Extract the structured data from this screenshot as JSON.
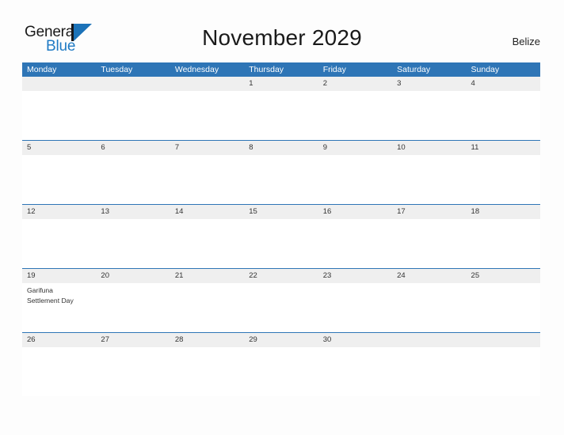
{
  "brand": {
    "name_part1": "General",
    "name_part2": "Blue",
    "flag_icon": "flag-triangle-icon",
    "accent_color": "#1b72b8"
  },
  "header": {
    "title": "November 2029",
    "country": "Belize"
  },
  "theme": {
    "header_blue": "#2e75b6",
    "band_gray": "#efefef",
    "page_background": "#fdfdfd",
    "text_color": "#333333"
  },
  "calendar": {
    "month": "November",
    "year": "2029",
    "first_day_of_week": "Monday",
    "weekday_headers": [
      "Monday",
      "Tuesday",
      "Wednesday",
      "Thursday",
      "Friday",
      "Saturday",
      "Sunday"
    ],
    "weeks": [
      {
        "days": [
          {
            "num": "",
            "event": ""
          },
          {
            "num": "",
            "event": ""
          },
          {
            "num": "",
            "event": ""
          },
          {
            "num": "1",
            "event": ""
          },
          {
            "num": "2",
            "event": ""
          },
          {
            "num": "3",
            "event": ""
          },
          {
            "num": "4",
            "event": ""
          }
        ]
      },
      {
        "days": [
          {
            "num": "5",
            "event": ""
          },
          {
            "num": "6",
            "event": ""
          },
          {
            "num": "7",
            "event": ""
          },
          {
            "num": "8",
            "event": ""
          },
          {
            "num": "9",
            "event": ""
          },
          {
            "num": "10",
            "event": ""
          },
          {
            "num": "11",
            "event": ""
          }
        ]
      },
      {
        "days": [
          {
            "num": "12",
            "event": ""
          },
          {
            "num": "13",
            "event": ""
          },
          {
            "num": "14",
            "event": ""
          },
          {
            "num": "15",
            "event": ""
          },
          {
            "num": "16",
            "event": ""
          },
          {
            "num": "17",
            "event": ""
          },
          {
            "num": "18",
            "event": ""
          }
        ]
      },
      {
        "days": [
          {
            "num": "19",
            "event": "Garifuna\nSettlement Day"
          },
          {
            "num": "20",
            "event": ""
          },
          {
            "num": "21",
            "event": ""
          },
          {
            "num": "22",
            "event": ""
          },
          {
            "num": "23",
            "event": ""
          },
          {
            "num": "24",
            "event": ""
          },
          {
            "num": "25",
            "event": ""
          }
        ]
      },
      {
        "days": [
          {
            "num": "26",
            "event": ""
          },
          {
            "num": "27",
            "event": ""
          },
          {
            "num": "28",
            "event": ""
          },
          {
            "num": "29",
            "event": ""
          },
          {
            "num": "30",
            "event": ""
          },
          {
            "num": "",
            "event": ""
          },
          {
            "num": "",
            "event": ""
          }
        ]
      }
    ]
  }
}
